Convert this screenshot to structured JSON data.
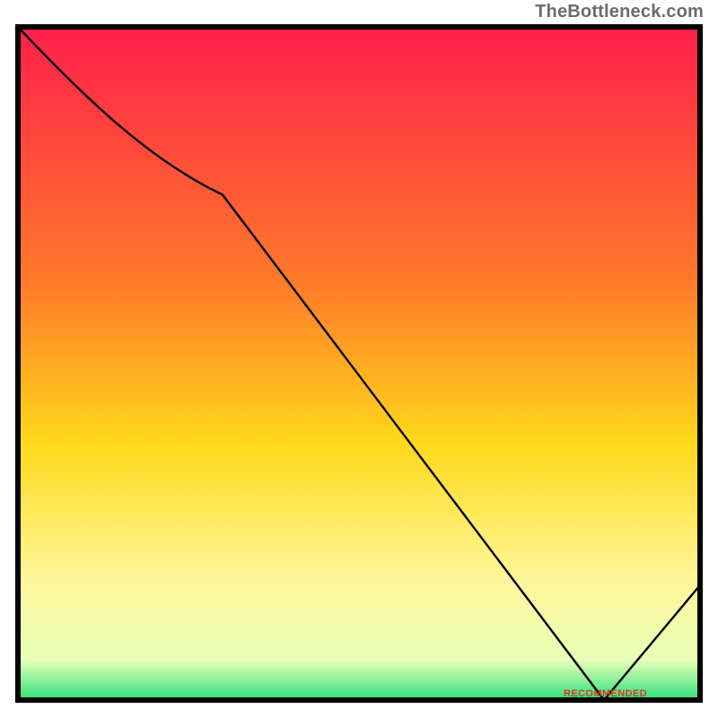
{
  "attribution": "TheBottleneck.com",
  "marker_label": "RECOMMENDED",
  "chart_data": {
    "type": "line",
    "title": "",
    "xlabel": "",
    "ylabel": "",
    "xlim": [
      0,
      100
    ],
    "ylim": [
      0,
      100
    ],
    "x": [
      0,
      30,
      86,
      100
    ],
    "values": [
      100,
      75,
      0,
      17
    ],
    "annotations": [
      {
        "text": "RECOMMENDED",
        "x": 86,
        "y": 0
      }
    ],
    "background": "vertical-gradient red→orange→yellow→pale-yellow→green",
    "gradient_stops": [
      {
        "pos": 0,
        "color": "#ff1f4b"
      },
      {
        "pos": 38,
        "color": "#ff7a2a"
      },
      {
        "pos": 62,
        "color": "#ffd91a"
      },
      {
        "pos": 82,
        "color": "#fff79a"
      },
      {
        "pos": 94,
        "color": "#e9ffb8"
      },
      {
        "pos": 100,
        "color": "#2fe07a"
      }
    ]
  }
}
